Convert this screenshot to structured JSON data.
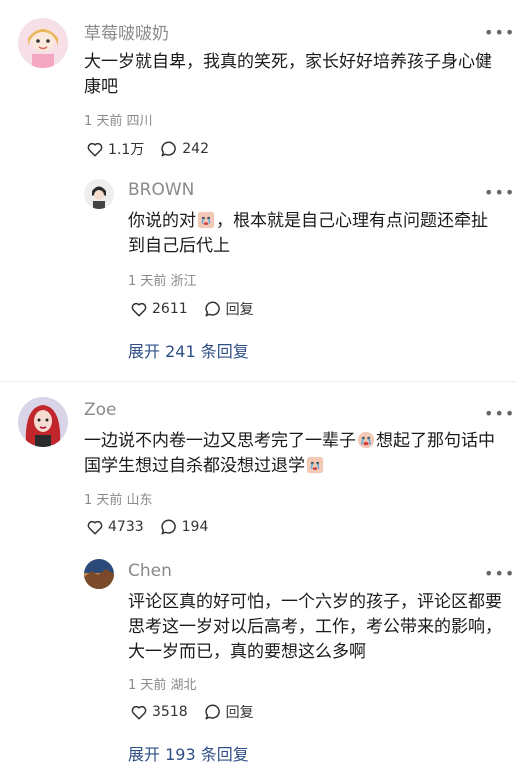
{
  "comments": [
    {
      "user": "草莓啵啵奶",
      "text": "大一岁就自卑，我真的笑死，家长好好培养孩子身心健康吧",
      "time": "1 天前",
      "location": "四川",
      "likes": "1.1万",
      "replies": "242",
      "reply": {
        "user": "BROWN",
        "text_before": "你说的对",
        "text_after": "，根本就是自己心理有点问题还牵扯到自己后代上",
        "time": "1 天前",
        "location": "浙江",
        "likes": "2611",
        "reply_label": "回复"
      },
      "expand_label": "展开 241 条回复"
    },
    {
      "user": "Zoe",
      "text_before": "一边说不内卷一边又思考完了一辈子",
      "text_mid": "想起了那句话中国学生想过自杀都没想过退学",
      "time": "1 天前",
      "location": "山东",
      "likes": "4733",
      "replies": "194",
      "reply": {
        "user": "Chen",
        "text": "评论区真的好可怕，一个六岁的孩子，评论区都要思考这一岁对以后高考，工作，考公带来的影响，大一岁而已，真的要想这么多啊",
        "time": "1 天前",
        "location": "湖北",
        "likes": "3518",
        "reply_label": "回复"
      },
      "expand_label": "展开 193 条回复"
    }
  ],
  "icons": {
    "like": "heart-outline-icon",
    "comment": "speech-bubble-icon",
    "more": "more-dots-icon"
  },
  "colors": {
    "link": "#2f4f88",
    "meta": "#8a8a8a"
  }
}
